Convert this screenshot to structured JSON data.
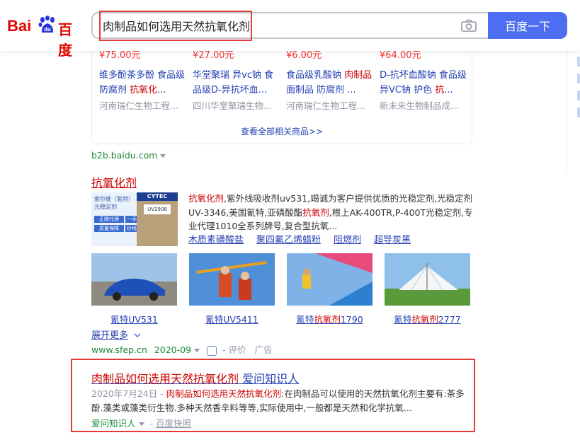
{
  "header": {
    "logo_bai": "Bai",
    "logo_du_paw": "du",
    "logo_du_cn": "百度",
    "search_query": "肉制品如何选用天然抗氧化剂",
    "search_button": "百度一下"
  },
  "products": [
    {
      "price": "¥75.00元",
      "title_a": "维多酚茶多酚 食品级防腐剂 ",
      "title_em": "抗氧化",
      "title_b": "...",
      "shop": "河南瑞仁生物工程..."
    },
    {
      "price": "¥27.00元",
      "title_a": "华堂聚瑞 异vc钠 食品级D-异抗坏血...",
      "title_em": "",
      "title_b": "",
      "shop": "四川华堂聚瑞生物..."
    },
    {
      "price": "¥6.00元",
      "title_a": "食品级乳酸钠 ",
      "title_em": "肉制品",
      "title_b": "面制品 防腐剂 ...",
      "shop": "河南瑞仁生物工程..."
    },
    {
      "price": "¥64.00元",
      "title_a": "D-抗坏血酸钠 食品级异VC钠 护色 ",
      "title_em": "抗",
      "title_b": "...",
      "shop": "新未来生物制品成..."
    }
  ],
  "see_all": "查看全部相关商品>>",
  "b2b_source": "b2b.baidu.com",
  "ad": {
    "title": "抗氧化剂",
    "img_label_a": "索尔维（氰特）",
    "img_label_b": "光稳定剂",
    "img_brand": "CYTEC",
    "img_code": "UV2908",
    "img_tags": [
      "正牌代理",
      "一手货源",
      "质量保障",
      "价格优惠"
    ],
    "desc_em1": "抗氧化剂",
    "desc_a": ",紫外线吸收剂uv531,竭诚为客户提供优质的光稳定剂,光稳定剂UV-3346,美国氰特,亚磷酸酯",
    "desc_em2": "抗氧剂",
    "desc_b": ",根上AK-400TR,P-400T光稳定剂,专业代理1010全系列牌号,复合型抗氧...",
    "links": [
      "木质素磺酸盐",
      "聚四氟乙烯蜡粉",
      "阻燃剂",
      "超导炭黑"
    ],
    "pics": [
      {
        "cap_a": "氰特UV531",
        "cap_em": "",
        "cap_b": ""
      },
      {
        "cap_a": "氰特UV5411",
        "cap_em": "",
        "cap_b": ""
      },
      {
        "cap_a": "氰特",
        "cap_em": "抗氧剂",
        "cap_b": "1790"
      },
      {
        "cap_a": "氰特",
        "cap_em": "抗氧剂",
        "cap_b": "2777"
      }
    ],
    "expand_more": "展开更多",
    "source": "www.sfep.cn",
    "date": "2020-09",
    "review": "- 评价",
    "ad_tag": "广告"
  },
  "result": {
    "title_em": "肉制品如何选用天然抗氧化剂",
    "title_b": " 爱问知识人",
    "date": "2020年7月24日 - ",
    "abs_em": "肉制品如何选用天然抗氧化剂",
    "abs_a": ":在肉制品可以使用的天然抗氧化剂主要有:茶多酚.藻类或藻类衍生物.多种天然香辛料等等,实际使用中,一般都是天然和化学抗氧...",
    "source": "爱问知识人",
    "snapshot": "百度快照"
  }
}
